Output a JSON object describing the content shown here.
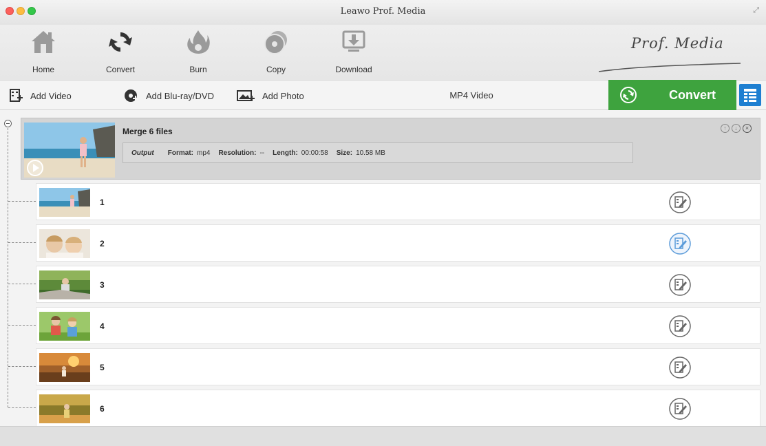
{
  "window": {
    "title": "Leawo Prof. Media"
  },
  "toolbar": {
    "items": [
      {
        "label": "Home",
        "icon": "home-icon"
      },
      {
        "label": "Convert",
        "icon": "convert-icon"
      },
      {
        "label": "Burn",
        "icon": "burn-icon"
      },
      {
        "label": "Copy",
        "icon": "copy-icon"
      },
      {
        "label": "Download",
        "icon": "download-icon"
      }
    ],
    "brand": "Prof. Media"
  },
  "actionbar": {
    "add_video": "Add Video",
    "add_bluray": "Add Blu-ray/DVD",
    "add_photo": "Add Photo",
    "format": "MP4 Video",
    "convert": "Convert"
  },
  "merge": {
    "title": "Merge 6 files",
    "output_label": "Output",
    "format_label": "Format:",
    "format_value": "mp4",
    "resolution_label": "Resolution:",
    "resolution_value": "--",
    "length_label": "Length:",
    "length_value": "00:00:58",
    "size_label": "Size:",
    "size_value": "10.58 MB"
  },
  "files": [
    {
      "num": "1",
      "scene": "beach-child"
    },
    {
      "num": "2",
      "scene": "kids-kiss"
    },
    {
      "num": "3",
      "scene": "child-grass"
    },
    {
      "num": "4",
      "scene": "two-kids"
    },
    {
      "num": "5",
      "scene": "sunset-field"
    },
    {
      "num": "6",
      "scene": "autumn-child"
    }
  ],
  "colors": {
    "accent_green": "#3ea33e",
    "accent_blue": "#1e7fd1",
    "edit_active": "#5b9bd9"
  }
}
